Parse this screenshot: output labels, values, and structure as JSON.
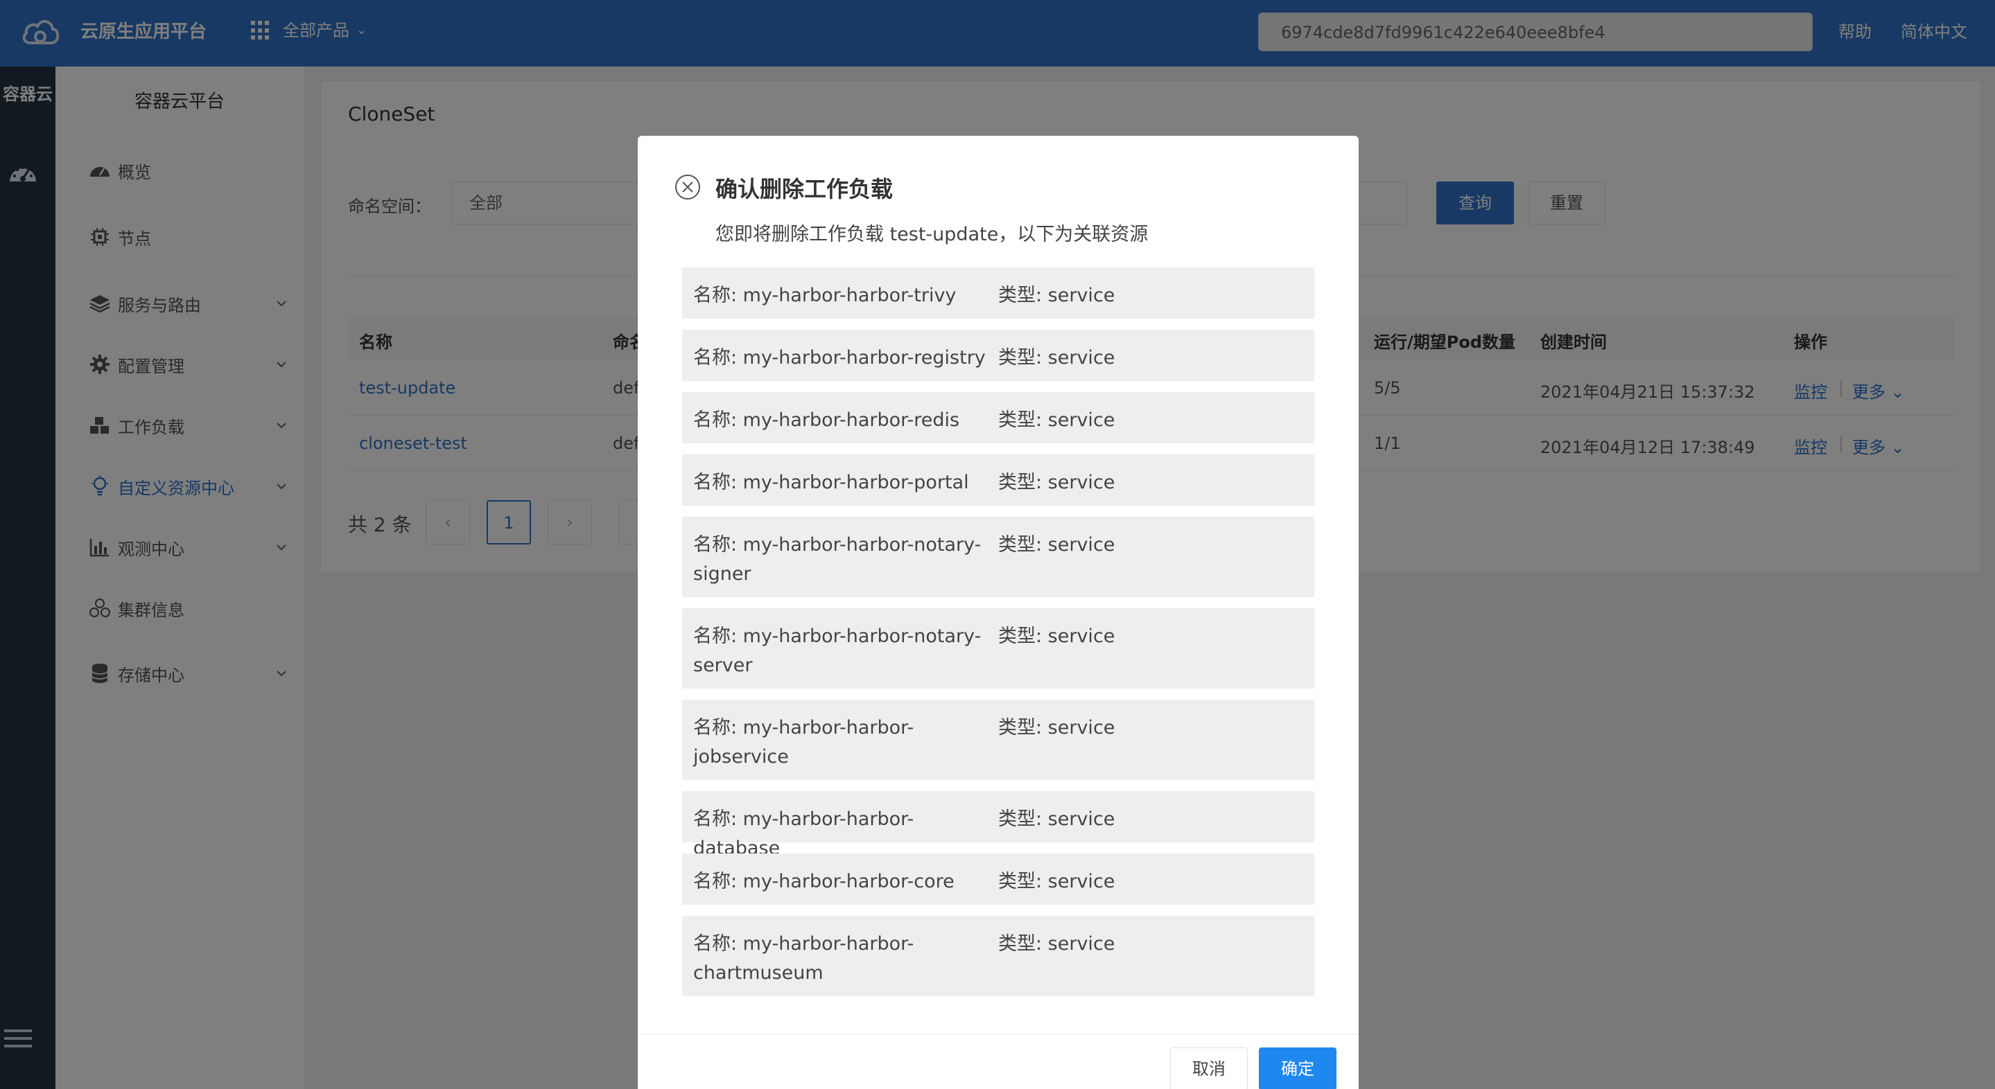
{
  "header": {
    "app_title": "云原生应用平台",
    "products_label": "全部产品",
    "search_value": "6974cde8d7fd9961c422e640eee8bfe4",
    "help_label": "帮助",
    "language_label": "简体中文",
    "bar_color": "#2f73c7"
  },
  "rail": {
    "title": "容器云"
  },
  "sidebar": {
    "title": "容器云平台",
    "items": [
      {
        "label": "概览",
        "icon": "dashboard-icon"
      },
      {
        "label": "节点",
        "icon": "chip-icon"
      },
      {
        "label": "服务与路由",
        "icon": "layers-icon"
      },
      {
        "label": "配置管理",
        "icon": "gear-icon"
      },
      {
        "label": "工作负载",
        "icon": "cubes-icon"
      },
      {
        "label": "自定义资源中心",
        "icon": "bulb-icon",
        "active": true
      },
      {
        "label": "观测中心",
        "icon": "bar-chart-icon"
      },
      {
        "label": "集群信息",
        "icon": "cluster-icon"
      },
      {
        "label": "存储中心",
        "icon": "database-icon"
      }
    ]
  },
  "main": {
    "title": "CloneSet",
    "namespace_label": "命名空间：",
    "namespace_value": "全部",
    "query_label": "查询",
    "reset_label": "重置",
    "columns": [
      "名称",
      "命名",
      "运行/期望Pod数量",
      "创建时间",
      "操作"
    ],
    "rows": [
      {
        "name": "test-update",
        "namespace": "def",
        "pods": "5/5",
        "created": "2021年04月21日 15:37:32",
        "monitor": "监控",
        "more": "更多"
      },
      {
        "name": "cloneset-test",
        "namespace": "def",
        "pods": "1/1",
        "created": "2021年04月12日 17:38:49",
        "monitor": "监控",
        "more": "更多"
      }
    ],
    "pager": {
      "total": "共 2 条",
      "current_page": "1"
    }
  },
  "modal": {
    "title": "确认删除工作负载",
    "description": "您即将删除工作负载 test-update，以下为关联资源",
    "resources": [
      {
        "name": "名称: my-harbor-harbor-trivy",
        "type": "类型: service"
      },
      {
        "name": "名称: my-harbor-harbor-registry",
        "type": "类型: service"
      },
      {
        "name": "名称: my-harbor-harbor-redis",
        "type": "类型: service"
      },
      {
        "name": "名称: my-harbor-harbor-portal",
        "type": "类型: service"
      },
      {
        "name": "名称: my-harbor-harbor-notary-signer",
        "type": "类型: service"
      },
      {
        "name": "名称: my-harbor-harbor-notary-server",
        "type": "类型: service"
      },
      {
        "name": "名称: my-harbor-harbor-jobservice",
        "type": "类型: service"
      },
      {
        "name": "名称: my-harbor-harbor-database",
        "type": "类型: service"
      },
      {
        "name": "名称: my-harbor-harbor-core",
        "type": "类型: service"
      },
      {
        "name": "名称: my-harbor-harbor-chartmuseum",
        "type": "类型: service"
      }
    ],
    "cancel_label": "取消",
    "confirm_label": "确定",
    "confirm_color": "#1e88f0"
  }
}
